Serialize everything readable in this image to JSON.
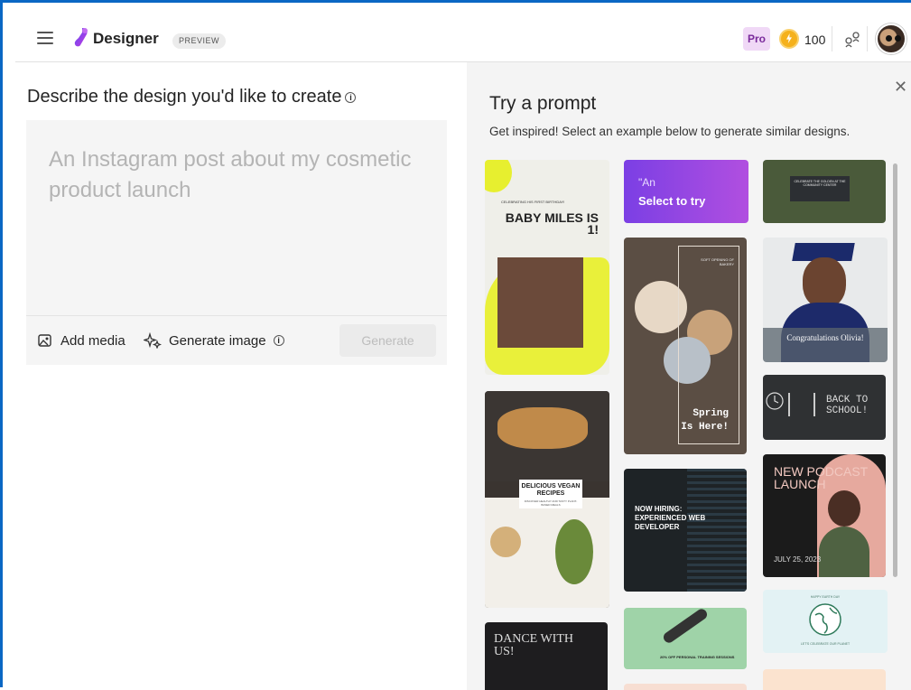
{
  "header": {
    "brand": "Designer",
    "badge": "PREVIEW",
    "pro": "Pro",
    "credits": "100",
    "icons": [
      "hamburger-menu-icon",
      "designer-logo-icon",
      "coin-icon",
      "share-icon",
      "user-avatar"
    ]
  },
  "left": {
    "question": "Describe the design you'd like to create",
    "placeholder": "An Instagram post about my cosmetic product launch",
    "add_media": "Add media",
    "generate_image": "Generate image",
    "generate": "Generate"
  },
  "panel": {
    "title": "Try a prompt",
    "subtitle": "Get inspired! Select an example below to generate similar designs.",
    "cards": {
      "baby_top": "CELEBRATING HIS FIRST BIRTHDAY!",
      "baby": "BABY MILES IS 1!",
      "prompt_quote": "\"An",
      "select": "Select to try",
      "community": "CELEBRATE THE GOLDEN AT THE COMMUNITY CENTER",
      "graduation": "Congratulations Olivia!",
      "bakery": "SOFT OPENING OF BAKERY",
      "spring": "Spring Is Here!",
      "back_school": "BACK TO SCHOOL!",
      "vegan": "DELICIOUS VEGAN RECIPES",
      "vegan_sub": "DISCOVER HEALTHY AND TASTY PLANT-BASED MEALS",
      "hiring": "NOW HIRING: EXPERIENCED WEB DEVELOPER",
      "podcast": "NEW PODCAST LAUNCH",
      "podcast_date": "JULY 25, 2023",
      "training": "20% OFF PERSONAL TRAINING SESSIONS",
      "earth_top": "HAPPY EARTH DAY",
      "earth": "LET'S CELEBRATE OUR PLANET",
      "dance": "DANCE WITH US!"
    }
  },
  "colors": {
    "accent": "#0a67c4",
    "pro_bg": "#f0d8f6",
    "select_grad_start": "#7b3fe4",
    "select_grad_end": "#b14fe0"
  }
}
